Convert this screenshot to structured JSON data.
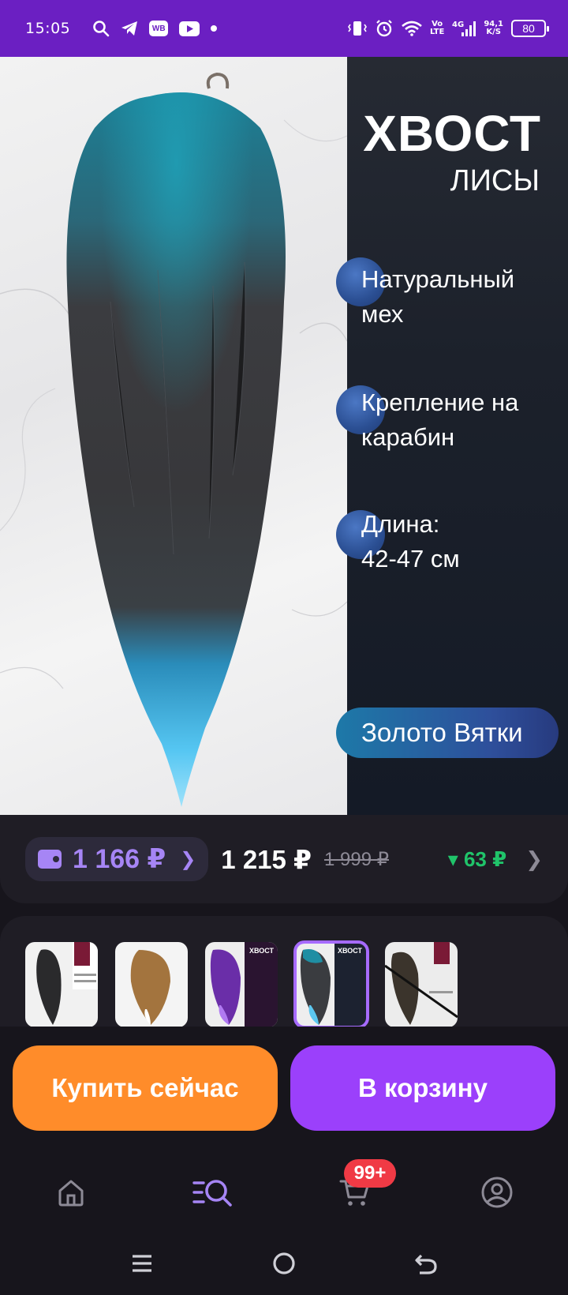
{
  "status_bar": {
    "time": "15:05",
    "icons_left": [
      "search-icon",
      "telegram-icon",
      "wb-icon",
      "youtube-icon",
      "dot-icon"
    ],
    "wb_label": "WB",
    "volte": "Vo\nLTE",
    "network": "4G",
    "speed": "94,1",
    "speed_unit": "K/S",
    "battery": "80"
  },
  "hero": {
    "title": "ХВОСТ",
    "subtitle": "ЛИСЫ",
    "features": [
      {
        "line1": "Натуральный",
        "line2": "мех"
      },
      {
        "line1": "Крепление на",
        "line2": "карабин"
      },
      {
        "line1": "Длина:",
        "line2": "42-47 см"
      }
    ],
    "brand": "Золото Вятки",
    "colors": {
      "fur_dark": "#3a3a3c",
      "fur_teal": "#1f8ea3",
      "fur_tip": "#5cc8f0"
    }
  },
  "price": {
    "wallet_price": "1 166 ₽",
    "current_price": "1 215 ₽",
    "old_price": "1 999 ₽",
    "discount": "▾ 63 ₽"
  },
  "thumbnails": [
    {
      "name": "black-tail",
      "selected": false
    },
    {
      "name": "red-fox-tail",
      "selected": false
    },
    {
      "name": "purple-tail",
      "selected": false
    },
    {
      "name": "blue-tail",
      "selected": true
    },
    {
      "name": "dark-brown-tail",
      "selected": false
    }
  ],
  "actions": {
    "buy_now": "Купить сейчас",
    "add_to_cart": "В корзину"
  },
  "bottom_nav": {
    "items": [
      "home-icon",
      "catalog-search-icon",
      "cart-icon",
      "profile-icon"
    ],
    "cart_badge": "99+",
    "active": "catalog-search-icon",
    "active_color": "#a685f5"
  },
  "system_nav": [
    "menu-icon",
    "home-circle-icon",
    "back-icon"
  ]
}
